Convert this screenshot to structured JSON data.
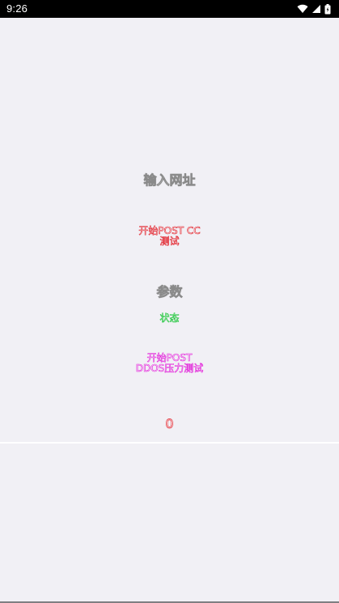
{
  "status_bar": {
    "time": "9:26",
    "icons": [
      "wifi-icon",
      "cellular-signal-icon",
      "battery-icon"
    ]
  },
  "form": {
    "url_placeholder": "输入网址",
    "post_cc_button": {
      "line1": "开始POST CC",
      "line2": "测试"
    },
    "params_placeholder": "参数",
    "status_label": "状态",
    "post_ddos_button": {
      "line1": "开始POST",
      "line2": "DDOS压力测试"
    },
    "counter": "0"
  },
  "colors": {
    "background": "#f1f0f5",
    "status_bar": "#000000",
    "input_outline": "#8a8a8a",
    "cc_button_outline": "#e0202a",
    "status_outline": "#1ec43a",
    "ddos_button_outline": "#e020d8",
    "counter_outline": "#e0202a"
  }
}
